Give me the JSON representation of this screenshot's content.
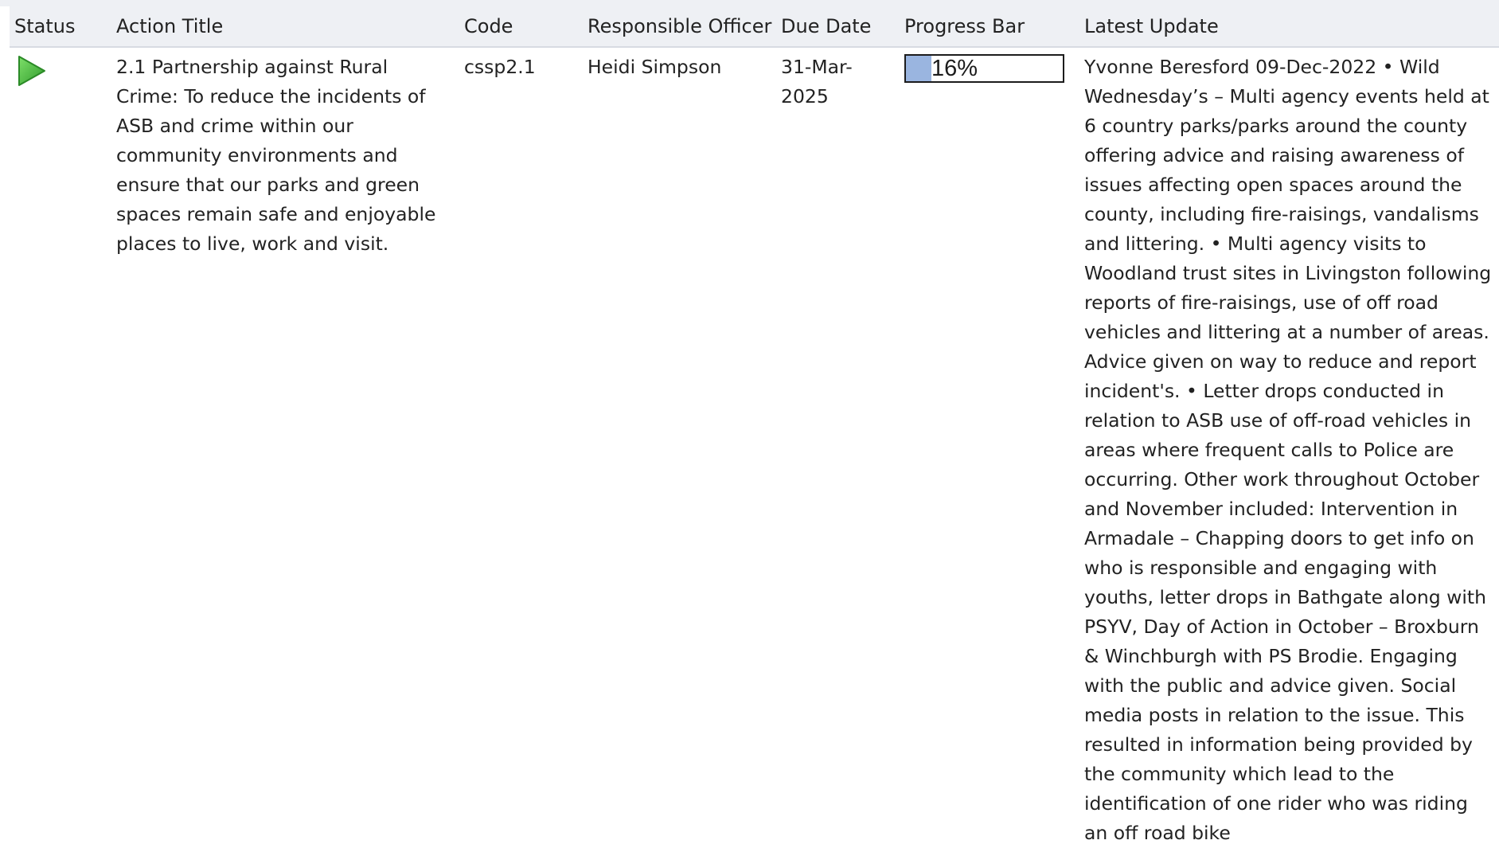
{
  "header": {
    "status": "Status",
    "action_title": "Action Title",
    "code": "Code",
    "responsible_officer": "Responsible Officer",
    "due_date": "Due Date",
    "progress_bar": "Progress Bar",
    "latest_update": "Latest Update"
  },
  "rows": [
    {
      "status_icon": "play-status-icon",
      "status_color": "#3cb043",
      "action_title": "2.1 Partnership against Rural Crime: To reduce the incidents of ASB and crime within our community environments and ensure that our parks and green spaces remain safe and enjoyable places to live, work and visit.",
      "code": "cssp2.1",
      "responsible_officer": "Heidi Simpson",
      "due_date": "31-Mar-2025",
      "progress_label": "16%",
      "progress_value": 0.16,
      "latest_update": "Yvonne Beresford 09-Dec-2022 • Wild Wednesday’s – Multi agency events held at 6 country parks/parks around the county offering advice and raising awareness of issues affecting open spaces around the county, including fire-raisings, vandalisms and littering. • Multi agency visits to Woodland trust sites in Livingston following reports of fire-raisings, use of off road vehicles and littering at a number of areas. Advice given on way to reduce and report incident's. • Letter drops conducted in relation to ASB use of off-road vehicles in areas where frequent calls to Police are occurring. Other work throughout October and November included: Intervention in Armadale – Chapping doors to get info on who is responsible and engaging with youths, letter drops in Bathgate along with PSYV, Day of Action in October – Broxburn & Winchburgh with PS Brodie. Engaging with the public and advice given. Social media posts in relation to the issue. This resulted in information being provided by the community which lead to the identification of one rider who was riding an off road bike"
    }
  ]
}
